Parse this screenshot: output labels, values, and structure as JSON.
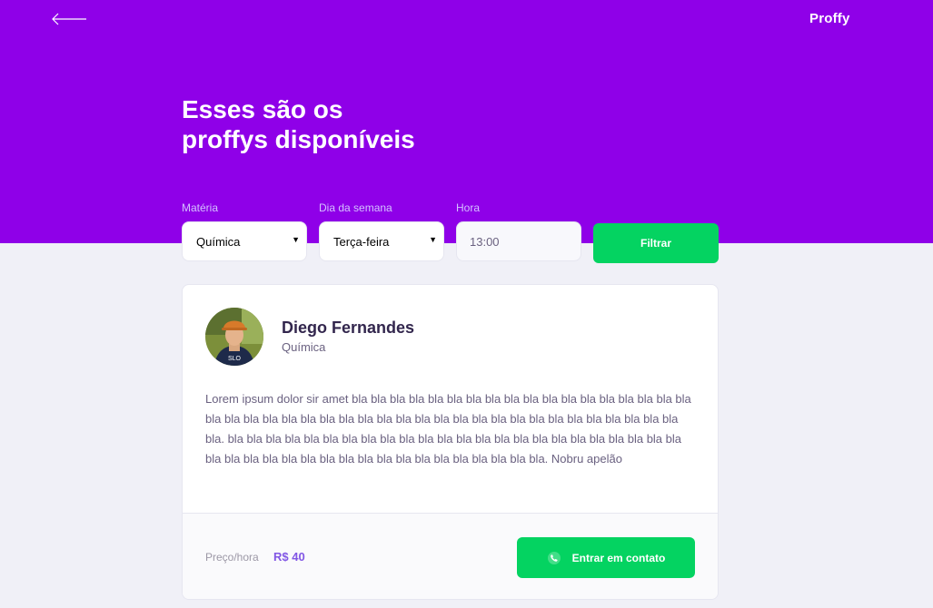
{
  "header": {
    "logo": "Proffy",
    "title_line1": "Esses são os",
    "title_line2": "proffys disponíveis",
    "back_icon": "arrow-left-icon"
  },
  "filters": {
    "subject": {
      "label": "Matéria",
      "value": "Química"
    },
    "week_day": {
      "label": "Dia da semana",
      "value": "Terça-feira"
    },
    "time": {
      "label": "Hora",
      "value": "13:00"
    },
    "button_label": "Filtrar"
  },
  "teacher": {
    "name": "Diego Fernandes",
    "subject": "Química",
    "bio": "Lorem ipsum dolor sir amet bla bla bla bla bla bla bla bla bla bla bla bla bla bla bla bla bla bla bla bla bla bla bla bla bla bla bla bla bla bla bla bla bla bla bla bla bla bla bla bla bla bla bla bla. bla bla bla bla bla bla bla bla bla bla bla bla bla bla bla bla bla bla bla bla bla bla bla bla bla bla bla bla bla bla bla bla bla bla bla bla bla bla bla bla bla bla. Nobru apelão",
    "price_label": "Preço/hora",
    "price_value": "R$ 40",
    "contact_label": "Entrar em contato",
    "contact_icon": "whatsapp-icon"
  },
  "colors": {
    "primary": "#8f00e8",
    "secondary": "#04d361",
    "background": "#f0f0f7"
  }
}
